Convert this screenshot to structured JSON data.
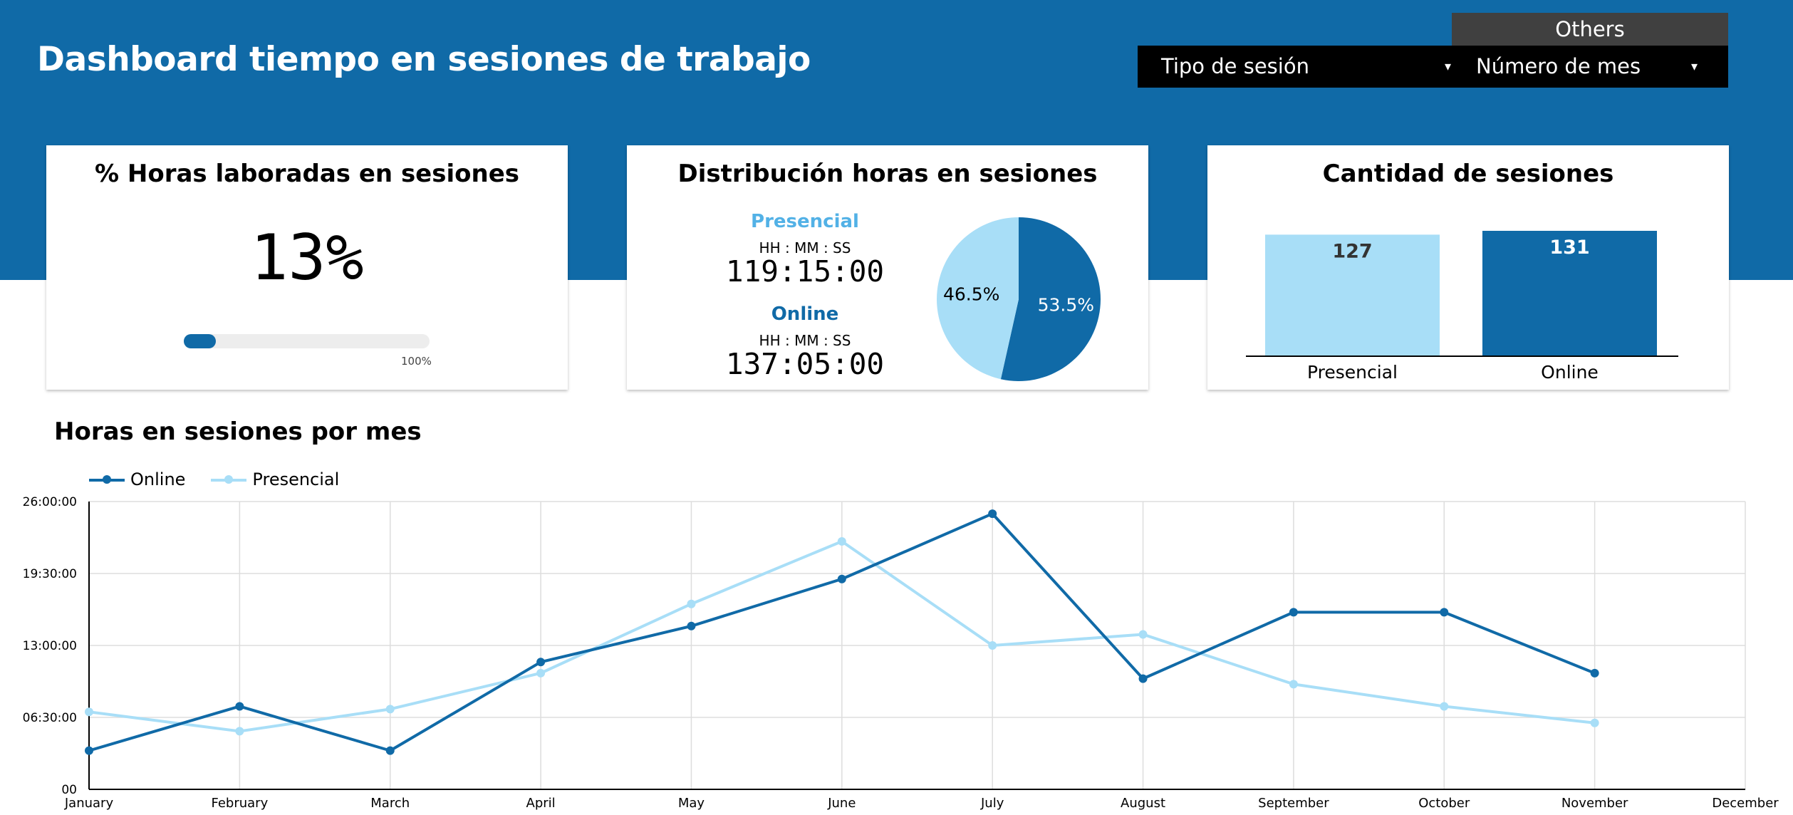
{
  "header": {
    "title": "Dashboard tiempo en sesiones de trabajo",
    "others_tab": "Others",
    "filters": [
      {
        "label": "Tipo de sesión"
      },
      {
        "label": "Número de mes"
      }
    ],
    "caret_glyph": "▾"
  },
  "colors": {
    "brand_blue": "#106aa7",
    "light_blue": "#a8def7",
    "presencial_label": "#52b1e6"
  },
  "kpi": {
    "title": "% Horas laboradas en sesiones",
    "value": "13%",
    "progress_fraction": 0.13,
    "progress_max_label": "100%"
  },
  "distribution": {
    "title": "Distribución horas en sesiones",
    "presencial": {
      "label": "Presencial",
      "unit": "HH : MM : SS",
      "time": "119:15:00"
    },
    "online": {
      "label": "Online",
      "unit": "HH : MM : SS",
      "time": "137:05:00"
    }
  },
  "sessions": {
    "title": "Cantidad de sesiones"
  },
  "monthly": {
    "title": "Horas en sesiones por mes"
  },
  "chart_data": [
    {
      "type": "pie",
      "labels": [
        "Online",
        "Presencial"
      ],
      "values": [
        53.5,
        46.5
      ],
      "value_labels": [
        "53.5%",
        "46.5%"
      ],
      "colors": [
        "#106aa7",
        "#a8def7"
      ]
    },
    {
      "type": "bar",
      "categories": [
        "Presencial",
        "Online"
      ],
      "values": [
        127,
        131
      ],
      "colors": [
        "#a8def7",
        "#106aa7"
      ]
    },
    {
      "type": "line",
      "x": [
        "January",
        "February",
        "March",
        "April",
        "May",
        "June",
        "July",
        "August",
        "September",
        "October",
        "November",
        "December"
      ],
      "y_ticks": [
        "00",
        "06:30:00",
        "13:00:00",
        "19:30:00",
        "26:00:00"
      ],
      "ylim_hours": [
        0,
        26
      ],
      "grid": true,
      "legend": "top-left",
      "series": [
        {
          "name": "Online",
          "color": "#106aa7",
          "values": [
            3.5,
            7.5,
            3.5,
            11.5,
            14.75,
            19.0,
            24.9,
            10.0,
            16.0,
            16.0,
            10.5,
            null
          ]
        },
        {
          "name": "Presencial",
          "color": "#a8def7",
          "values": [
            7.0,
            5.25,
            7.25,
            10.5,
            16.75,
            22.4,
            13.0,
            14.0,
            9.5,
            7.5,
            6.0,
            null
          ]
        }
      ]
    }
  ]
}
